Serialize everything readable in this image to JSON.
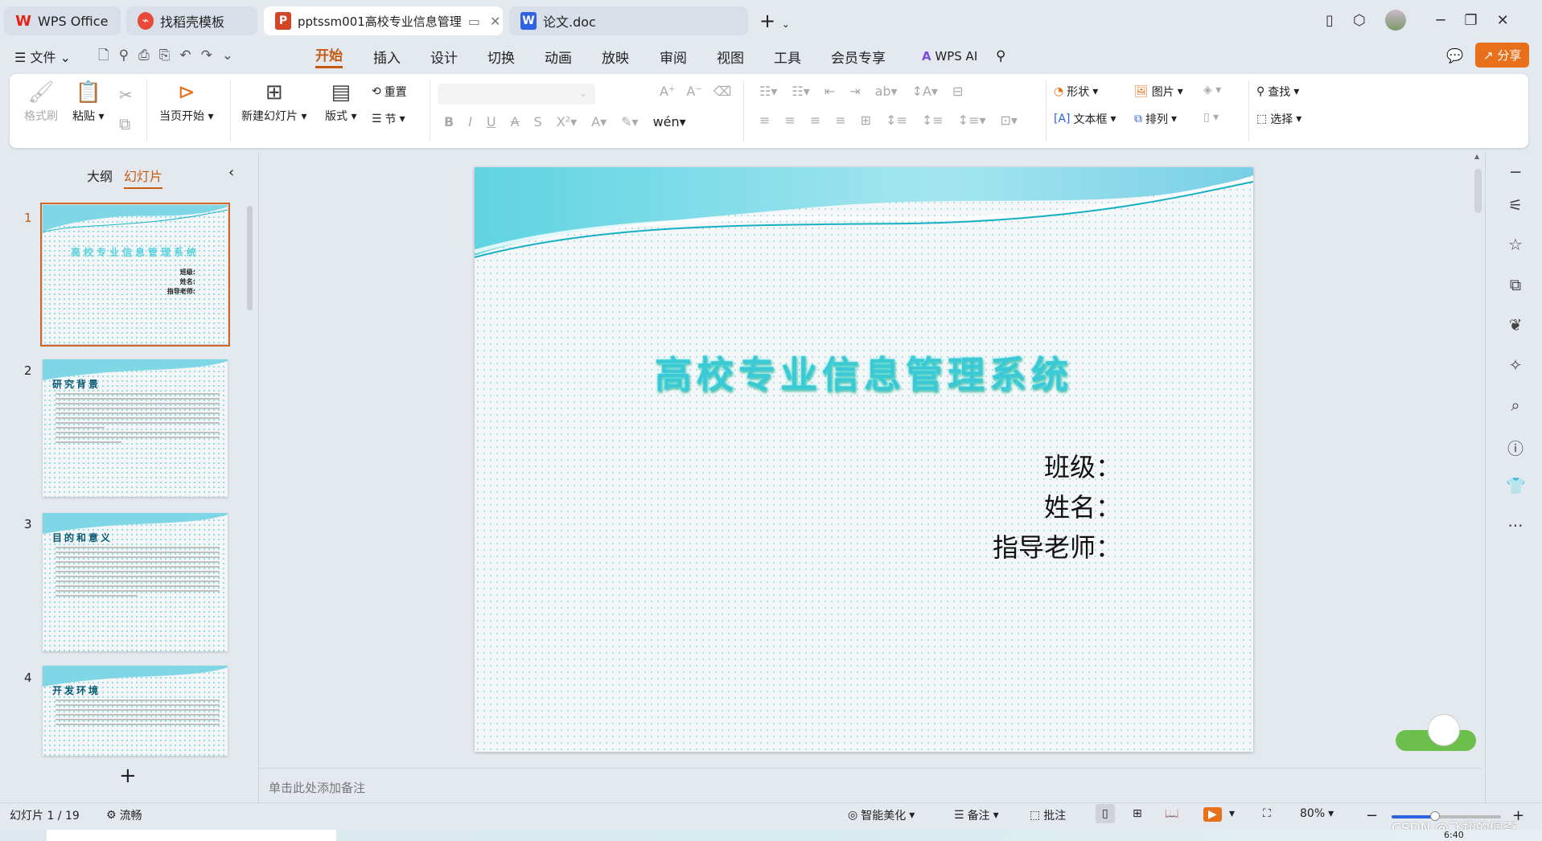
{
  "tabs": [
    {
      "label": "WPS Office",
      "icon": "wps-logo-icon",
      "color": "#e2231a"
    },
    {
      "label": "找稻壳模板",
      "icon": "docer-icon",
      "color": "#e84a3a"
    },
    {
      "label": "pptssm001高校专业信息管理",
      "icon": "ppt-icon",
      "color": "#d24625"
    },
    {
      "label": "论文.doc",
      "icon": "word-icon",
      "color": "#2f62e0"
    }
  ],
  "menu": {
    "file": "文件",
    "items": [
      "开始",
      "插入",
      "设计",
      "切换",
      "动画",
      "放映",
      "审阅",
      "视图",
      "工具",
      "会员专享"
    ],
    "active": "开始",
    "wps_ai": "WPS AI",
    "share": "分享"
  },
  "ribbon": {
    "format_painter": "格式刷",
    "paste": "粘贴",
    "start_current": "当页开始",
    "new_slide": "新建幻灯片",
    "layout": "版式",
    "reset": "重置",
    "section": "节",
    "shape": "形状",
    "picture": "图片",
    "textbox": "文本框",
    "arrange": "排列",
    "find": "查找",
    "select": "选择"
  },
  "left_panel": {
    "tab_outline": "大纲",
    "tab_slides": "幻灯片",
    "active": "幻灯片",
    "slides": [
      {
        "num": "1",
        "title": "高校专业信息管理系统"
      },
      {
        "num": "2",
        "title": "研究背景"
      },
      {
        "num": "3",
        "title": "目的和意义"
      },
      {
        "num": "4",
        "title": "开发环境"
      }
    ],
    "thumb1_fields": [
      "班级:",
      "姓名:",
      "指导老师:"
    ]
  },
  "slide": {
    "title": "高校专业信息管理系统",
    "fields": [
      "班级：",
      "姓名：",
      "指导老师："
    ]
  },
  "notes_placeholder": "单击此处添加备注",
  "status": {
    "slide_counter": "幻灯片 1 / 19",
    "smooth": "流畅",
    "beautify": "智能美化",
    "notes": "备注",
    "comment": "批注",
    "zoom": "80%",
    "zoom_fraction": 0.4
  },
  "watermark": "CSDN @飞翔的佩奇",
  "clock": "6:40",
  "colors": {
    "accent": "#c55a11",
    "share": "#e8701a",
    "title": "#3cc9d6"
  }
}
